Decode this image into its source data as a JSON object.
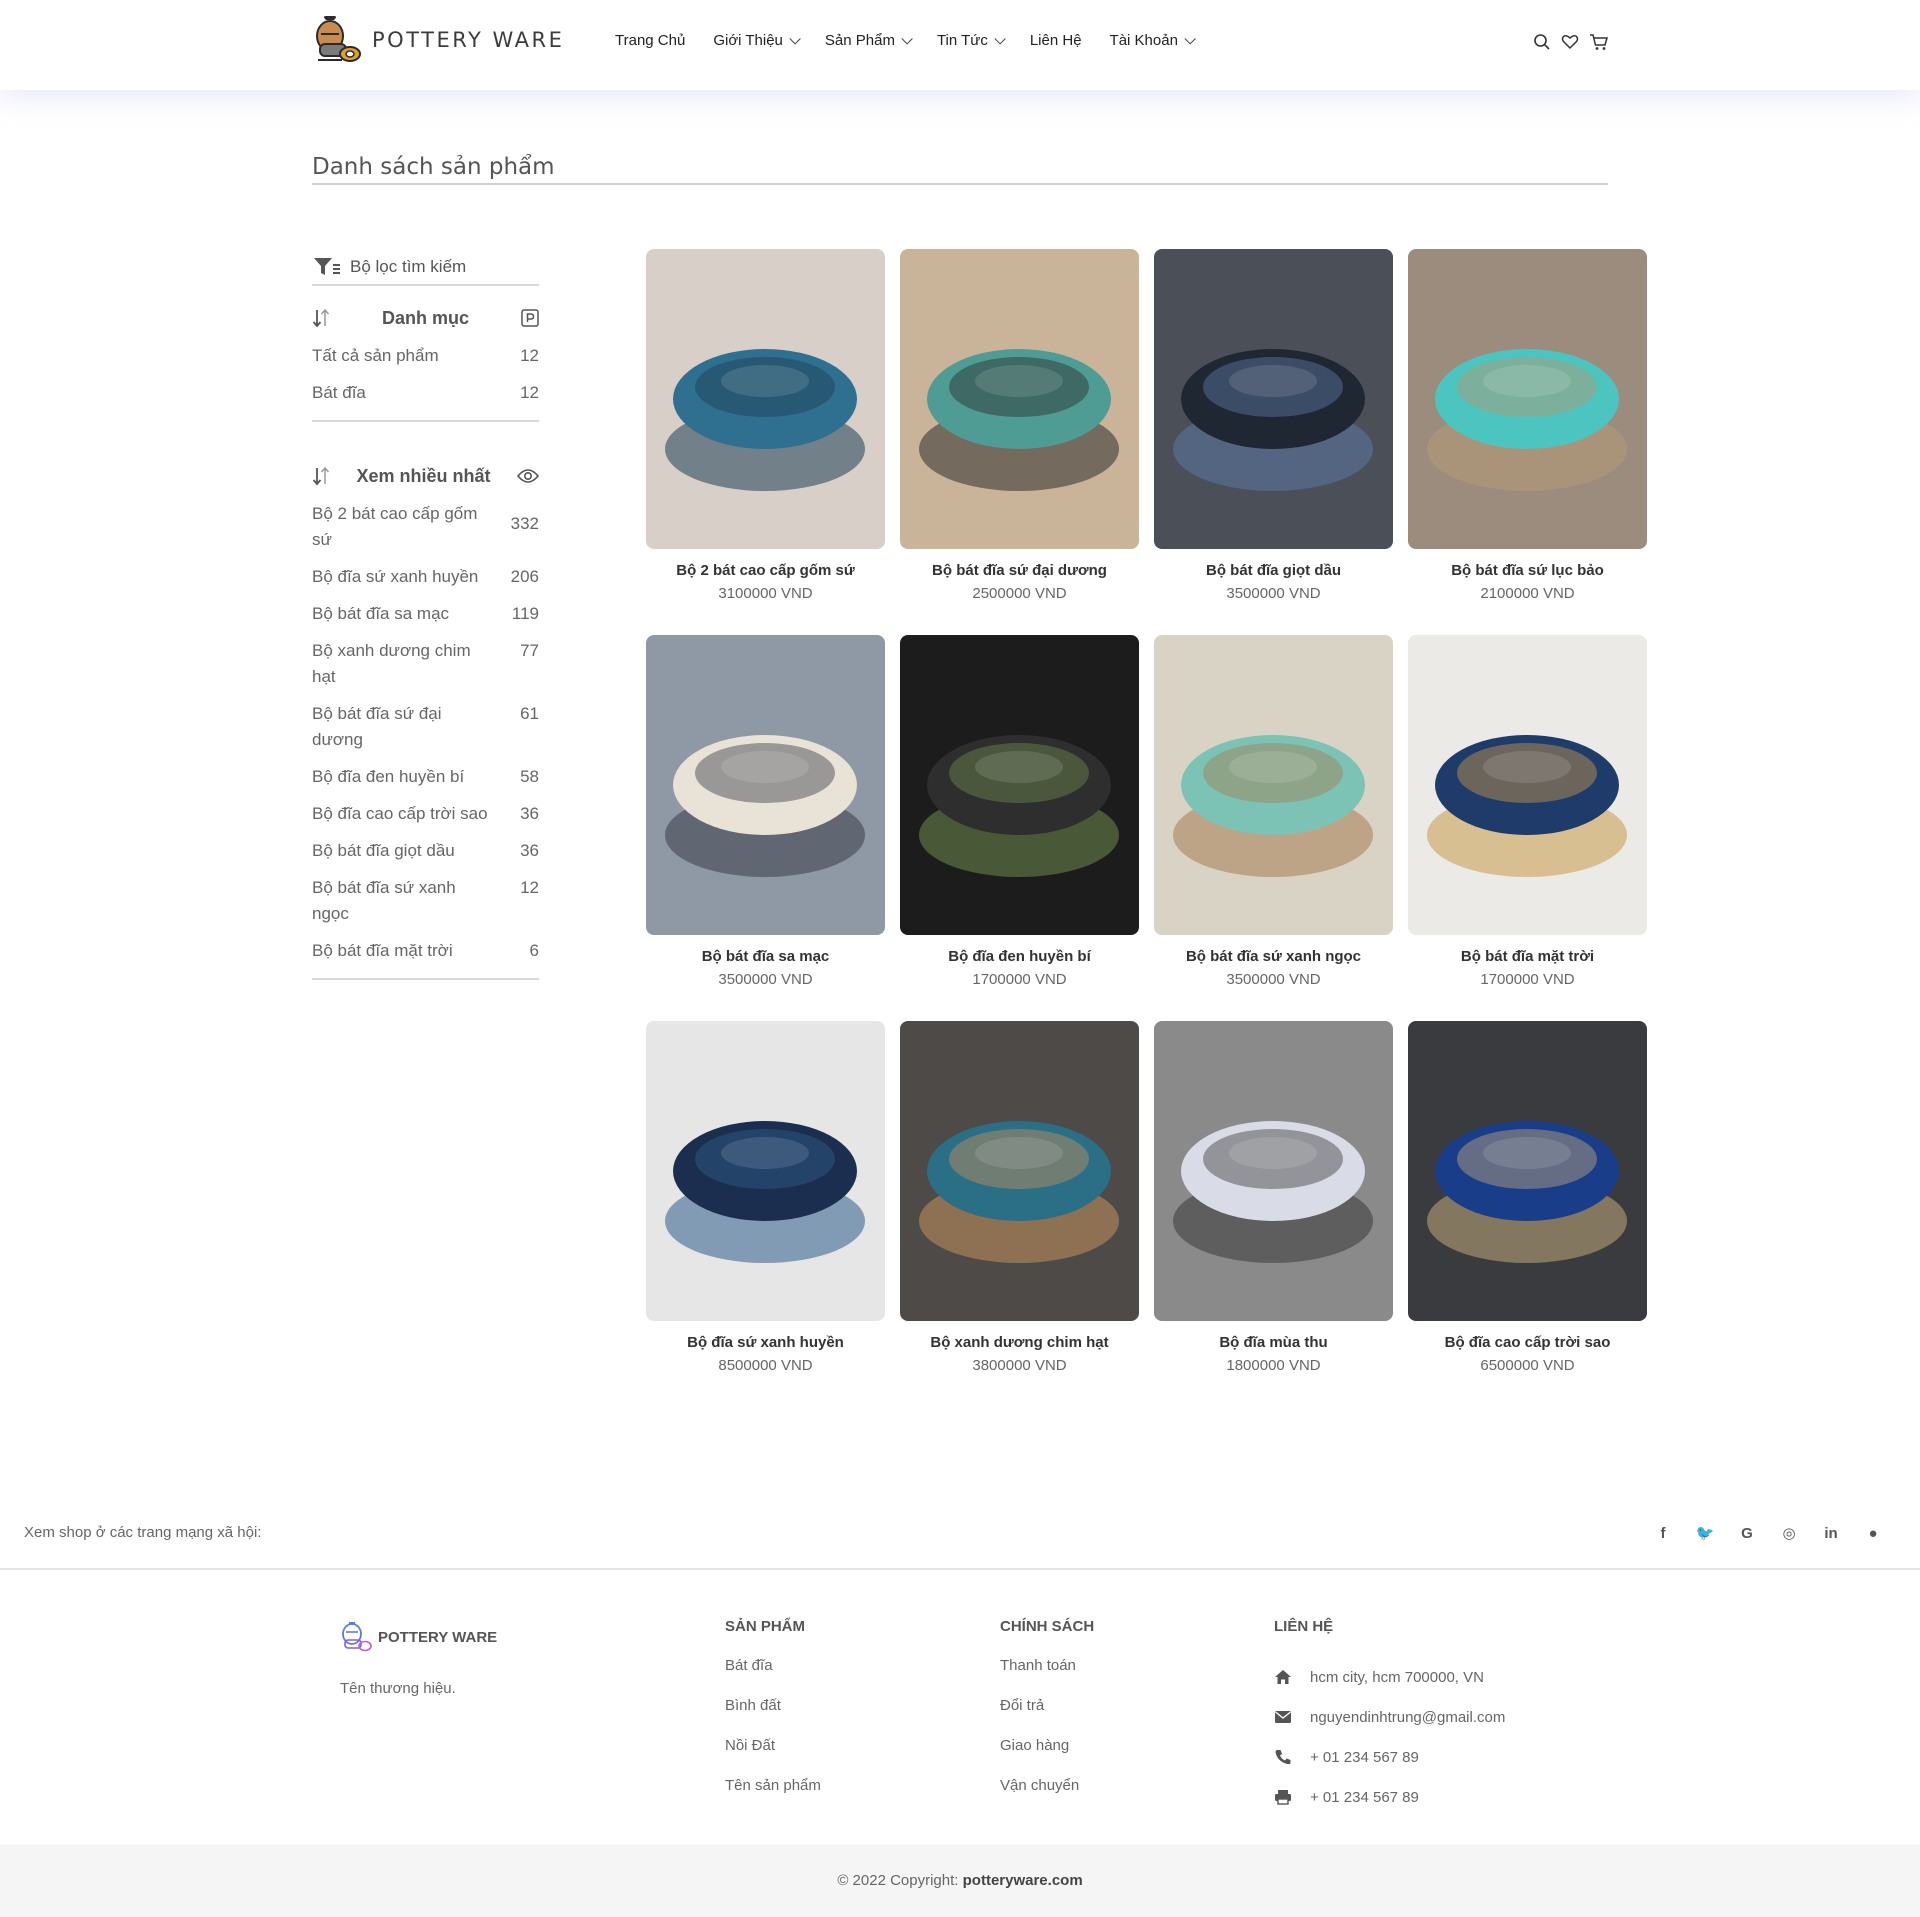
{
  "header": {
    "logo_text": "POTTERY WARE",
    "nav": [
      {
        "label": "Trang Chủ",
        "has_dropdown": false
      },
      {
        "label": "Giới Thiệu",
        "has_dropdown": true
      },
      {
        "label": "Sản Phẩm",
        "has_dropdown": true
      },
      {
        "label": "Tin Tức",
        "has_dropdown": true
      },
      {
        "label": "Liên Hệ",
        "has_dropdown": false
      },
      {
        "label": "Tài Khoản",
        "has_dropdown": true
      }
    ],
    "icons": [
      "search-icon",
      "heart-icon",
      "cart-icon"
    ]
  },
  "main": {
    "title": "Danh sách sản phẩm"
  },
  "sidebar": {
    "filter_label": "Bộ lọc tìm kiếm",
    "categories": {
      "title": "Danh mục",
      "items": [
        {
          "label": "Tất cả sản phẩm",
          "count": "12"
        },
        {
          "label": "Bát đĩa",
          "count": "12"
        }
      ]
    },
    "most_viewed": {
      "title": "Xem nhiều nhất",
      "items": [
        {
          "label": "Bộ 2 bát cao cấp gốm sứ",
          "count": "332"
        },
        {
          "label": "Bộ đĩa sứ xanh huyền",
          "count": "206"
        },
        {
          "label": "Bộ bát đĩa sa mạc",
          "count": "119"
        },
        {
          "label": "Bộ xanh dương chim hạt",
          "count": "77"
        },
        {
          "label": "Bộ bát đĩa sứ đại dương",
          "count": "61"
        },
        {
          "label": "Bộ đĩa đen huyền bí",
          "count": "58"
        },
        {
          "label": "Bộ đĩa cao cấp trời sao",
          "count": "36"
        },
        {
          "label": "Bộ bát đĩa giọt dầu",
          "count": "36"
        },
        {
          "label": "Bộ bát đĩa sứ xanh ngọc",
          "count": "12"
        },
        {
          "label": "Bộ bát đĩa mặt trời",
          "count": "6"
        }
      ]
    }
  },
  "products": [
    {
      "name": "Bộ 2 bát cao cấp gốm sứ",
      "price": "3100000 VND",
      "bg": "#d8cfc8",
      "fg": "#2f6f8f",
      "accent": "#1e3f55"
    },
    {
      "name": "Bộ bát đĩa sứ đại dương",
      "price": "2500000 VND",
      "bg": "#c9b49a",
      "fg": "#4e9c93",
      "accent": "#2d2d2d"
    },
    {
      "name": "Bộ bát đĩa giọt dầu",
      "price": "3500000 VND",
      "bg": "#4a4f58",
      "fg": "#1f2733",
      "accent": "#5d79a5"
    },
    {
      "name": "Bộ bát đĩa sứ lục bảo",
      "price": "2100000 VND",
      "bg": "#9c8c7e",
      "fg": "#4cc4c0",
      "accent": "#b79a74"
    },
    {
      "name": "Bộ bát đĩa sa mạc",
      "price": "3500000 VND",
      "bg": "#8f98a5",
      "fg": "#e8e2d7",
      "accent": "#3a3f49"
    },
    {
      "name": "Bộ đĩa đen huyền bí",
      "price": "1700000 VND",
      "bg": "#1c1c1c",
      "fg": "#2e2e2e",
      "accent": "#6f8a4f"
    },
    {
      "name": "Bộ bát đĩa sứ xanh ngọc",
      "price": "3500000 VND",
      "bg": "#d9d3c5",
      "fg": "#7cc3b5",
      "accent": "#a57e53"
    },
    {
      "name": "Bộ bát đĩa mặt trời",
      "price": "1700000 VND",
      "bg": "#eceae6",
      "fg": "#1f3b6a",
      "accent": "#c99a4b"
    },
    {
      "name": "Bộ đĩa sứ xanh huyền",
      "price": "8500000 VND",
      "bg": "#e6e6e6",
      "fg": "#1b2e4f",
      "accent": "#2f5d8a"
    },
    {
      "name": "Bộ xanh dương chim hạt",
      "price": "3800000 VND",
      "bg": "#4d4a47",
      "fg": "#2a6f86",
      "accent": "#c48f5b"
    },
    {
      "name": "Bộ đĩa mùa thu",
      "price": "1800000 VND",
      "bg": "#8a8a8a",
      "fg": "#d9dce6",
      "accent": "#3b3b3b"
    },
    {
      "name": "Bộ đĩa cao cấp trời sao",
      "price": "6500000 VND",
      "bg": "#3a3b3f",
      "fg": "#1a3d8a",
      "accent": "#bfa97a"
    }
  ],
  "social": {
    "text": "Xem shop ở các trang mạng xã hội:",
    "icons": [
      {
        "name": "facebook-icon",
        "glyph": "f"
      },
      {
        "name": "twitter-icon",
        "glyph": "🐦"
      },
      {
        "name": "google-icon",
        "glyph": "G"
      },
      {
        "name": "instagram-icon",
        "glyph": "◎"
      },
      {
        "name": "linkedin-icon",
        "glyph": "in"
      },
      {
        "name": "github-icon",
        "glyph": "●"
      }
    ]
  },
  "footer": {
    "brand": "POTTERY WARE",
    "tagline": "Tên thương hiệu.",
    "products": {
      "title": "SẢN PHẨM",
      "links": [
        "Bát đĩa",
        "Bình đất",
        "Nồi Đất",
        "Tên sản phẩm"
      ]
    },
    "policy": {
      "title": "CHÍNH SÁCH",
      "links": [
        "Thanh toán",
        "Đổi trả",
        "Giao hàng",
        "Vận chuyển"
      ]
    },
    "contact": {
      "title": "LIÊN HỆ",
      "address": "hcm city, hcm 700000, VN",
      "email": "nguyendinhtrung@gmail.com",
      "phone": "+ 01 234 567 89",
      "fax": "+ 01 234 567 89"
    }
  },
  "copyright": {
    "prefix": "© 2022 Copyright:",
    "site": "potteryware.com"
  }
}
